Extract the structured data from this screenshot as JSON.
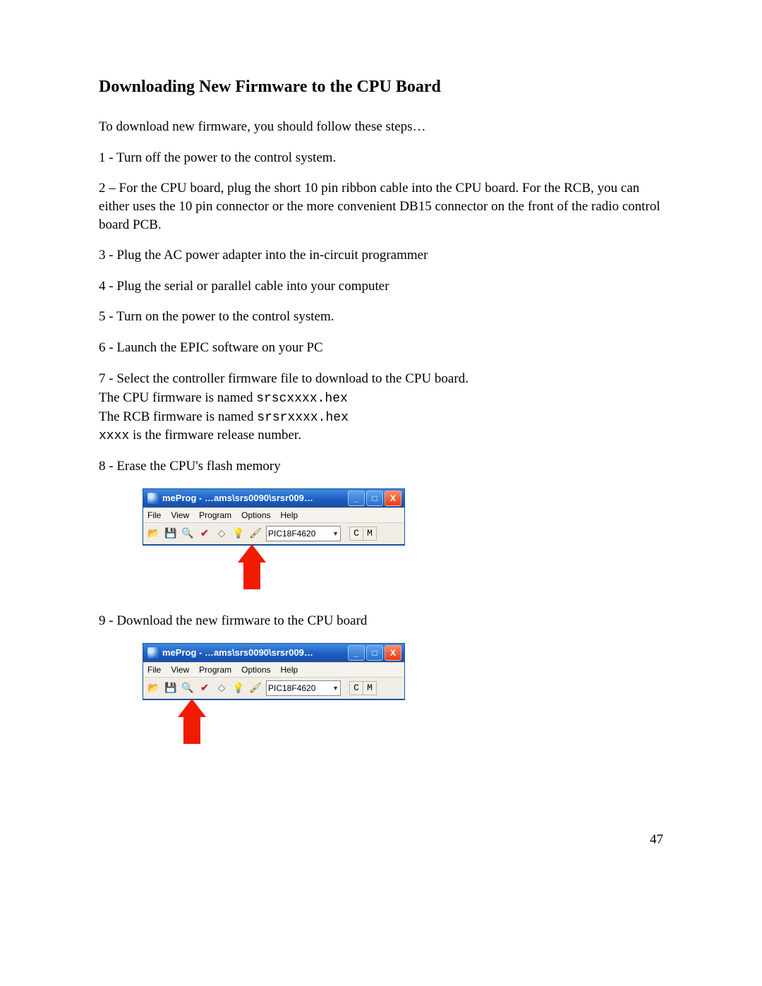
{
  "heading": "Downloading New Firmware to the CPU Board",
  "intro": "To download new firmware, you should follow these steps…",
  "step1": "1 - Turn off the power to the control system.",
  "step2": "2 – For the CPU board, plug the short 10 pin  ribbon cable into the CPU board.  For the RCB, you can either uses the 10 pin connector or the more convenient DB15 connector on the front of the radio control board PCB.",
  "step3": "3 - Plug the AC power adapter into the in-circuit programmer",
  "step4": "4 - Plug the serial or parallel cable into your computer",
  "step5": "5 - Turn on the power to the control system.",
  "step6": "6 - Launch the EPIC software on your PC",
  "step7": "7 - Select the controller firmware file to download to the CPU board.",
  "step7_a_prefix": "The CPU firmware is named  ",
  "step7_a_mono": "srscxxxx.hex",
  "step7_b_prefix": "The RCB firmware is named ",
  "step7_b_mono": "srsrxxxx.hex",
  "step7_c_mono": "xxxx",
  "step7_c_suffix": " is the firmware release number.",
  "step8": "8 - Erase the CPU's flash memory",
  "step9": "9 - Download the new firmware to the CPU board",
  "page_number": "47",
  "appwin": {
    "title": "meProg - …ams\\srs0090\\srsr009…",
    "menus": {
      "file": "File",
      "view": "View",
      "program": "Program",
      "options": "Options",
      "help": "Help"
    },
    "device": "PIC18F4620",
    "c_btn": "C",
    "m_btn": "M",
    "win_min": "_",
    "win_max": "□",
    "win_close": "X"
  },
  "arrow_left_1": 135,
  "arrow_left_2": 50
}
